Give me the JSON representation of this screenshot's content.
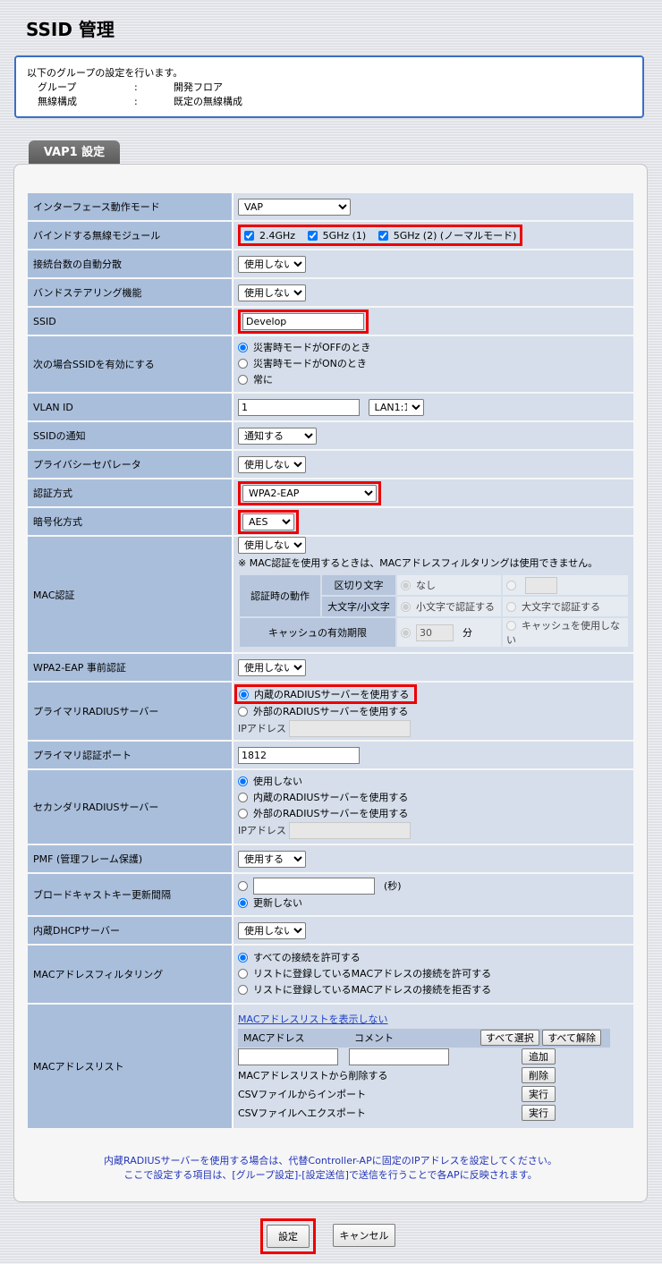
{
  "page_title": "SSID 管理",
  "info": {
    "lead": "以下のグループの設定を行います。",
    "rows": [
      {
        "key": "グループ",
        "sep": ":",
        "value": "開発フロア"
      },
      {
        "key": "無線構成",
        "sep": ":",
        "value": "既定の無線構成"
      }
    ]
  },
  "section_tab": "VAP1 設定",
  "rows": {
    "interface_mode": {
      "label": "インターフェース動作モード",
      "value": "VAP"
    },
    "bind_module": {
      "label": "バインドする無線モジュール",
      "options": [
        "2.4GHz",
        "5GHz (1)",
        "5GHz (2) (ノーマルモード)"
      ]
    },
    "auto_balance": {
      "label": "接続台数の自動分散",
      "value": "使用しない"
    },
    "band_steering": {
      "label": "バンドステアリング機能",
      "value": "使用しない"
    },
    "ssid": {
      "label": "SSID",
      "value": "Develop"
    },
    "enable_ssid_when": {
      "label": "次の場合SSIDを有効にする",
      "options": [
        "災害時モードがOFFのとき",
        "災害時モードがONのとき",
        "常に"
      ]
    },
    "vlan_id": {
      "label": "VLAN ID",
      "value": "1",
      "port": "LAN1:1"
    },
    "ssid_broadcast": {
      "label": "SSIDの通知",
      "value": "通知する"
    },
    "privacy_separator": {
      "label": "プライバシーセパレータ",
      "value": "使用しない"
    },
    "auth_method": {
      "label": "認証方式",
      "value": "WPA2-EAP"
    },
    "encryption": {
      "label": "暗号化方式",
      "value": "AES"
    },
    "mac_auth": {
      "label": "MAC認証",
      "value": "使用しない",
      "note": "※ MAC認証を使用するときは、MACアドレスフィルタリングは使用できません。",
      "auth_action": "認証時の動作",
      "delimiter": "区切り文字",
      "delimiter_none": "なし",
      "case": "大文字/小文字",
      "lowercase": "小文字で認証する",
      "uppercase": "大文字で認証する",
      "cache": "キャッシュの有効期限",
      "cache_value": "30",
      "cache_unit": "分",
      "no_cache": "キャッシュを使用しない"
    },
    "preauth": {
      "label": "WPA2-EAP 事前認証",
      "value": "使用しない"
    },
    "primary_radius": {
      "label": "プライマリRADIUSサーバー",
      "options": [
        "内蔵のRADIUSサーバーを使用する",
        "外部のRADIUSサーバーを使用する"
      ],
      "ip_label": "IPアドレス"
    },
    "primary_port": {
      "label": "プライマリ認証ポート",
      "value": "1812"
    },
    "secondary_radius": {
      "label": "セカンダリRADIUSサーバー",
      "options": [
        "使用しない",
        "内蔵のRADIUSサーバーを使用する",
        "外部のRADIUSサーバーを使用する"
      ],
      "ip_label": "IPアドレス"
    },
    "pmf": {
      "label": "PMF (管理フレーム保護)",
      "value": "使用する"
    },
    "broadcast_key": {
      "label": "ブロードキャストキー更新間隔",
      "unit": "(秒)",
      "no_update": "更新しない"
    },
    "dhcp": {
      "label": "内蔵DHCPサーバー",
      "value": "使用しない"
    },
    "mac_filter": {
      "label": "MACアドレスフィルタリング",
      "options": [
        "すべての接続を許可する",
        "リストに登録しているMACアドレスの接続を許可する",
        "リストに登録しているMACアドレスの接続を拒否する"
      ]
    },
    "mac_list": {
      "label": "MACアドレスリスト",
      "link": "MACアドレスリストを表示しない",
      "col_mac": "MACアドレス",
      "col_comment": "コメント",
      "select_all": "すべて選択",
      "deselect_all": "すべて解除",
      "add": "追加",
      "delete_label": "MACアドレスリストから削除する",
      "delete": "削除",
      "import_label": "CSVファイルからインポート",
      "export_label": "CSVファイルへエクスポート",
      "run": "実行"
    }
  },
  "footer_notes": [
    "内蔵RADIUSサーバーを使用する場合は、代替Controller-APに固定のIPアドレスを設定してください。",
    "ここで設定する項目は、[グループ設定]-[設定送信]で送信を行うことで各APに反映されます。"
  ],
  "buttons": {
    "submit": "設定",
    "cancel": "キャンセル"
  }
}
